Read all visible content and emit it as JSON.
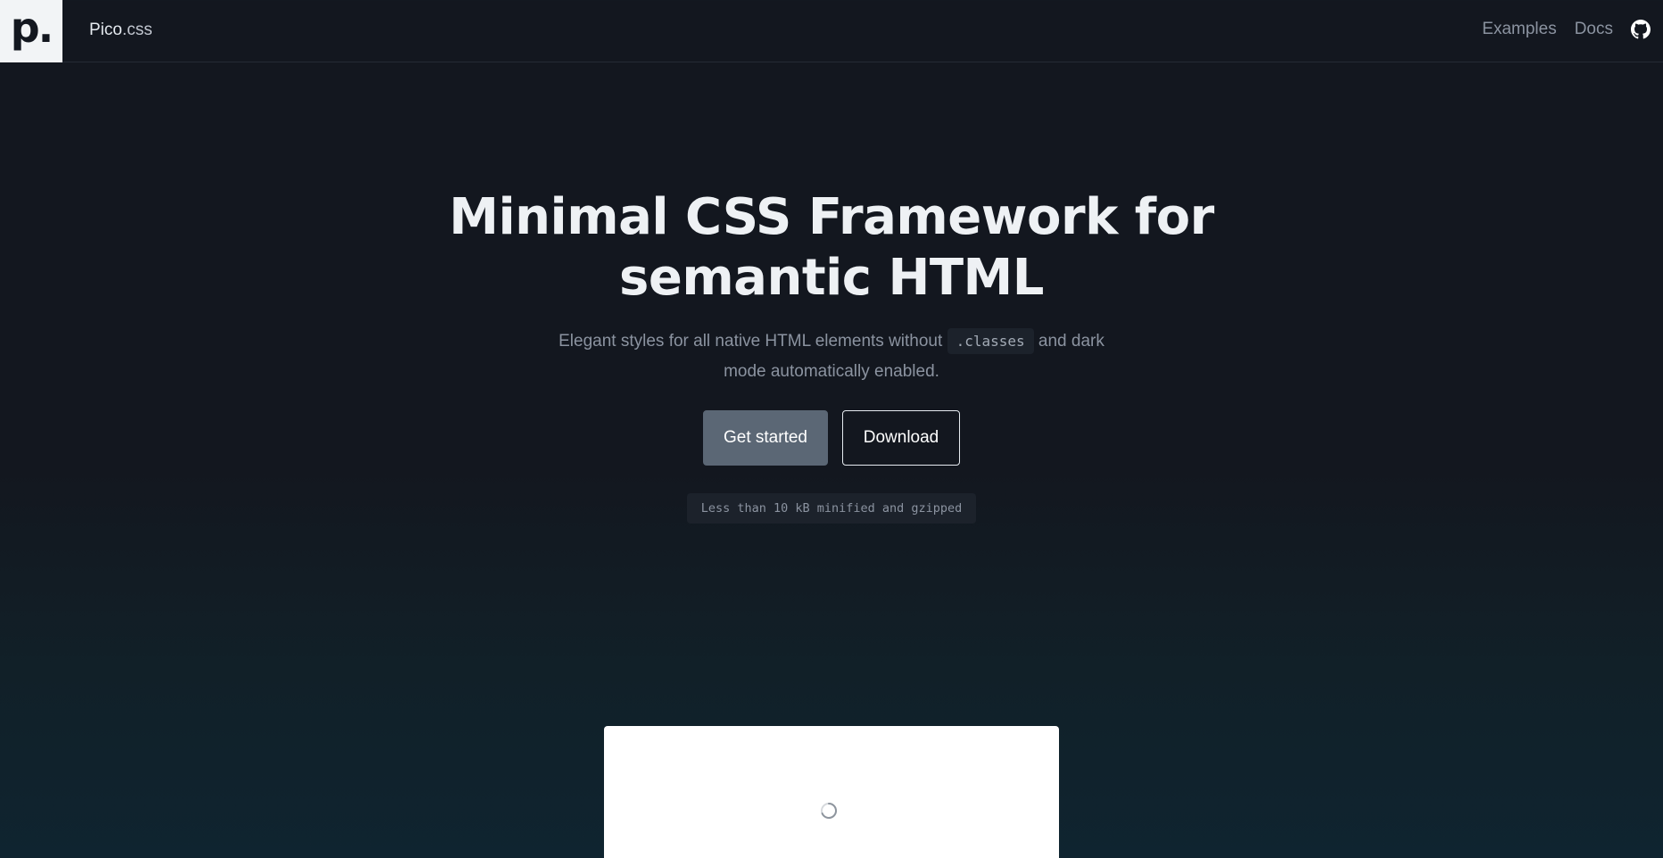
{
  "header": {
    "logo_glyph": "p.",
    "brand_name": "Pico",
    "brand_suffix": ".css",
    "nav": [
      {
        "label": "Examples"
      },
      {
        "label": "Docs"
      }
    ],
    "github_icon": "github-icon"
  },
  "hero": {
    "title_line1": "Minimal CSS Framework for",
    "title_line2": "semantic HTML",
    "subtitle_before": "Elegant styles for all native HTML elements without",
    "subtitle_code": ".classes",
    "subtitle_after": "and dark mode automatically enabled.",
    "primary_button": "Get started",
    "secondary_button": "Download",
    "size_note": "Less than 10 kB minified and gzipped"
  },
  "demo": {
    "loading_icon": "spinner-icon"
  },
  "colors": {
    "background": "#13171f",
    "primary_button": "#5b6775",
    "muted_text": "#8b93a0"
  }
}
